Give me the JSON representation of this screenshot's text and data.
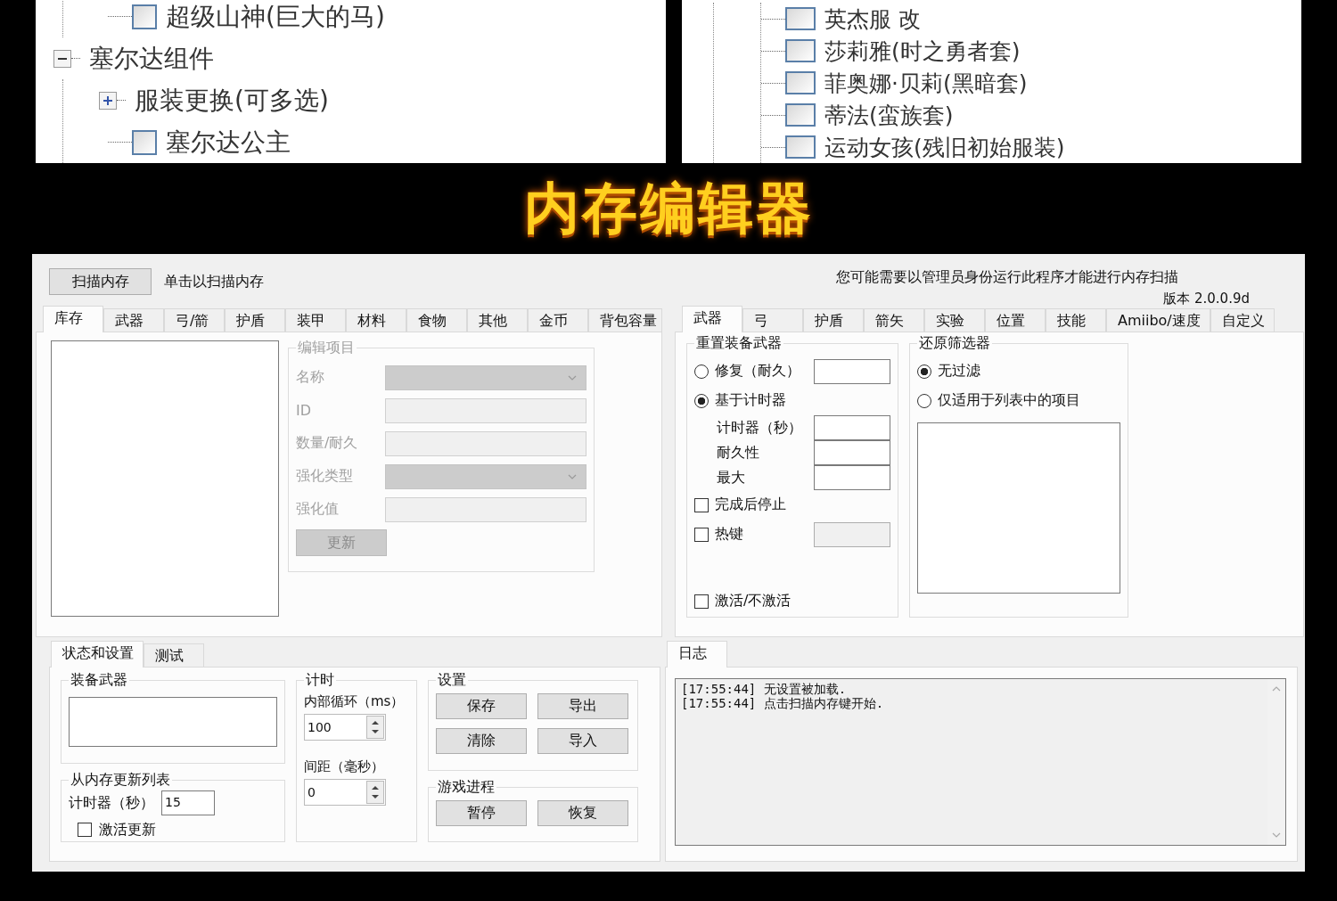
{
  "tree_left": {
    "cut_branch": [
      {
        "label": "超级山神(巨大的马)",
        "checked": false
      }
    ],
    "items": [
      {
        "kind": "group",
        "label": "塞尔达组件",
        "expanded": true,
        "children": [
          {
            "kind": "group",
            "label": "服装更换(可多选)",
            "expanded": false
          },
          {
            "kind": "check",
            "label": "塞尔达公主",
            "checked": false
          }
        ]
      }
    ]
  },
  "tree_right": {
    "cut_branch": [
      {
        "label": "英杰服 改",
        "checked": false
      },
      {
        "label": "莎莉雅(时之勇者套)",
        "checked": false
      },
      {
        "label": "菲奥娜·贝莉(黑暗套)",
        "checked": false
      },
      {
        "label": "蒂法(蛮族套)",
        "checked": false
      },
      {
        "label": "运动女孩(残旧初始服装)",
        "checked": false
      }
    ]
  },
  "banner_title": "内存编辑器",
  "window": {
    "scan_button": "扫描内存",
    "scan_hint": "单击以扫描内存",
    "admin_notice": "您可能需要以管理员身份运行此程序才能进行内存扫描",
    "version": "版本 2.0.0.9d",
    "item_tabs": [
      {
        "label": "库存",
        "selected": true
      },
      {
        "label": "武器",
        "selected": false
      },
      {
        "label": "弓/箭",
        "selected": false
      },
      {
        "label": "护盾",
        "selected": false
      },
      {
        "label": "装甲",
        "selected": false
      },
      {
        "label": "材料",
        "selected": false
      },
      {
        "label": "食物",
        "selected": false
      },
      {
        "label": "其他",
        "selected": false
      },
      {
        "label": "金币",
        "selected": false
      },
      {
        "label": "背包容量",
        "selected": false
      }
    ],
    "edit_group": {
      "title": "编辑项目",
      "disabled": true,
      "fields": [
        {
          "kind": "combo",
          "label": "名称"
        },
        {
          "kind": "text",
          "label": "ID"
        },
        {
          "kind": "text",
          "label": "数量/耐久"
        },
        {
          "kind": "combo",
          "label": "强化类型"
        },
        {
          "kind": "text",
          "label": "强化值"
        }
      ],
      "button": "更新"
    },
    "cheat_tabs": [
      {
        "label": "武器",
        "selected": true
      },
      {
        "label": "弓",
        "selected": false
      },
      {
        "label": "护盾",
        "selected": false
      },
      {
        "label": "箭矢",
        "selected": false
      },
      {
        "label": "实验",
        "selected": false
      },
      {
        "label": "位置",
        "selected": false
      },
      {
        "label": "技能",
        "selected": false
      },
      {
        "label": "Amiibo/速度",
        "selected": false
      },
      {
        "label": "自定义",
        "selected": false
      }
    ],
    "reset_group": {
      "title": "重置装备武器",
      "options": [
        {
          "label": "修复（耐久）",
          "selected": false
        },
        {
          "label": "基于计时器",
          "selected": true
        }
      ],
      "timer_fields": [
        "计时器（秒）",
        "耐久性",
        "最大"
      ],
      "stop_when_done": {
        "label": "完成后停止",
        "checked": false
      },
      "hotkey": {
        "label": "热键",
        "checked": false
      },
      "activate": {
        "label": "激活/不激活",
        "checked": false
      }
    },
    "filter_group": {
      "title": "还原筛选器",
      "options": [
        {
          "label": "无过滤",
          "selected": true
        },
        {
          "label": "仅适用于列表中的项目",
          "selected": false
        }
      ]
    },
    "status_tabs": [
      {
        "label": "状态和设置",
        "selected": true
      },
      {
        "label": "测试",
        "selected": false
      }
    ],
    "equipped_group": {
      "title": "装备武器"
    },
    "refresh_group": {
      "title": "从内存更新列表",
      "timer_label": "计时器（秒）",
      "timer_value": "15",
      "auto": {
        "label": "激活更新",
        "checked": false
      }
    },
    "timing_group": {
      "title": "计时",
      "spinners": [
        {
          "label": "内部循环（ms）",
          "value": "100"
        },
        {
          "label": "间距（毫秒）",
          "value": "0"
        }
      ]
    },
    "settings_group": {
      "title": "设置",
      "buttons": [
        "保存",
        "导出",
        "清除",
        "导入"
      ]
    },
    "process_group": {
      "title": "游戏进程",
      "buttons": [
        "暂停",
        "恢复"
      ]
    },
    "log_tabs": [
      {
        "label": "日志",
        "selected": true
      }
    ],
    "log_lines": [
      "[17:55:44] 无设置被加载.",
      "[17:55:44] 点击扫描内存键开始."
    ]
  }
}
